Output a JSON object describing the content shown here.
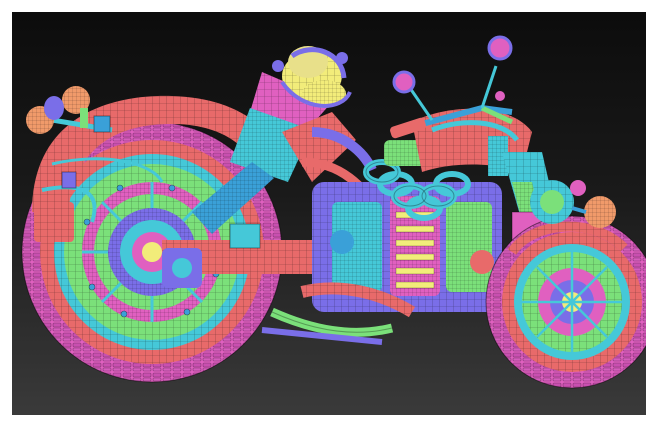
{
  "viewport": {
    "background_top": "#0c0c0c",
    "background_bottom": "#3a3a3a"
  },
  "subject": {
    "polygroup_colors": [
      "#e86a6a",
      "#7be07a",
      "#45c8d8",
      "#e060c0",
      "#f2ec7a",
      "#7a6ee8",
      "#3aa0d8",
      "#f09a6a"
    ],
    "parts": [
      "rear-wheel",
      "rear-fender",
      "rear-lights",
      "swing-arm",
      "exhaust-pipes",
      "engine",
      "coil-springs",
      "fuel-tank",
      "handlebars",
      "side-mirrors",
      "front-fork",
      "front-wheel",
      "headlight"
    ]
  }
}
